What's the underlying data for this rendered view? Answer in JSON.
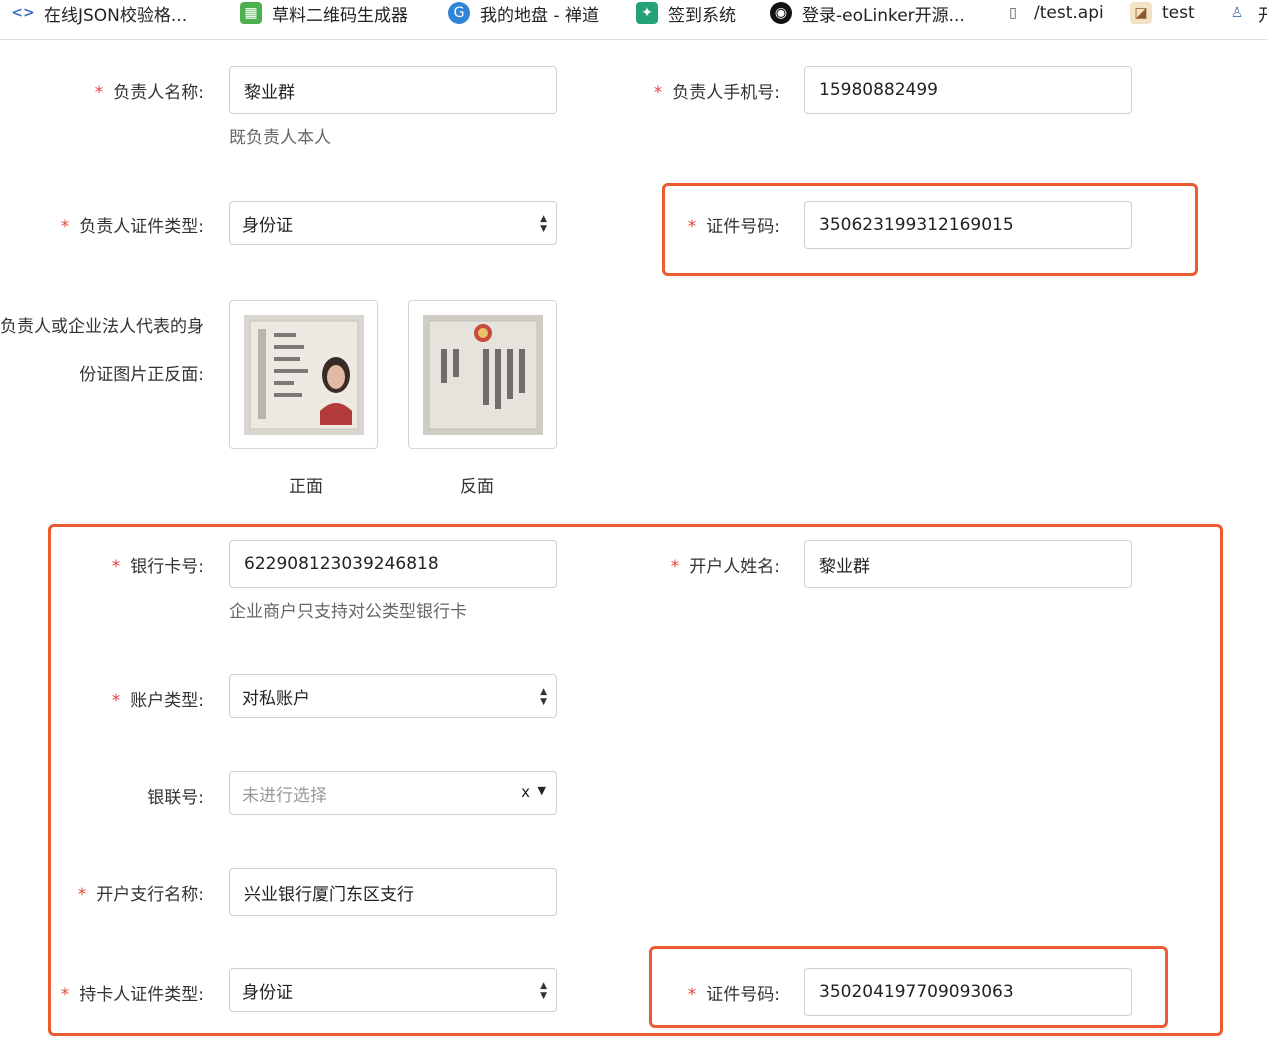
{
  "bookmarks": [
    {
      "label": "在线JSON校验格...",
      "icon": "code-icon"
    },
    {
      "label": "草料二维码生成器",
      "icon": "qr-icon"
    },
    {
      "label": "我的地盘 - 禅道",
      "icon": "swirl-icon"
    },
    {
      "label": "签到系统",
      "icon": "sign-icon"
    },
    {
      "label": "登录-eoLinker开源...",
      "icon": "eo-icon"
    },
    {
      "label": "/test.api",
      "icon": "document-icon"
    },
    {
      "label": "test",
      "icon": "image-icon"
    },
    {
      "label": "开",
      "icon": "figure-icon"
    }
  ],
  "form": {
    "owner_name": {
      "label": "负责人名称:",
      "value": "黎业群",
      "hint": "既负责人本人"
    },
    "owner_phone": {
      "label": "负责人手机号:",
      "value": "15980882499"
    },
    "owner_id_type": {
      "label": "负责人证件类型:",
      "value": "身份证"
    },
    "owner_id_number": {
      "label": "证件号码:",
      "value": "350623199312169015"
    },
    "id_photos": {
      "label_line1": "负责人或企业法人代表的身",
      "label_line2": "份证图片正反面:",
      "front_caption": "正面",
      "back_caption": "反面"
    },
    "bank_card": {
      "label": "银行卡号:",
      "value": "622908123039246818",
      "hint": "企业商户只支持对公类型银行卡"
    },
    "account_holder": {
      "label": "开户人姓名:",
      "value": "黎业群"
    },
    "account_type": {
      "label": "账户类型:",
      "value": "对私账户"
    },
    "union_number": {
      "label": "银联号:",
      "placeholder": "未进行选择",
      "clear": "x"
    },
    "branch_name": {
      "label": "开户支行名称:",
      "value": "兴业银行厦门东区支行"
    },
    "holder_id_type": {
      "label": "持卡人证件类型:",
      "value": "身份证"
    },
    "holder_id_number": {
      "label": "证件号码:",
      "value": "350204197709093063"
    }
  },
  "required_mark": "*",
  "colors": {
    "required": "#e4463c",
    "highlight": "#ec5a2f"
  }
}
